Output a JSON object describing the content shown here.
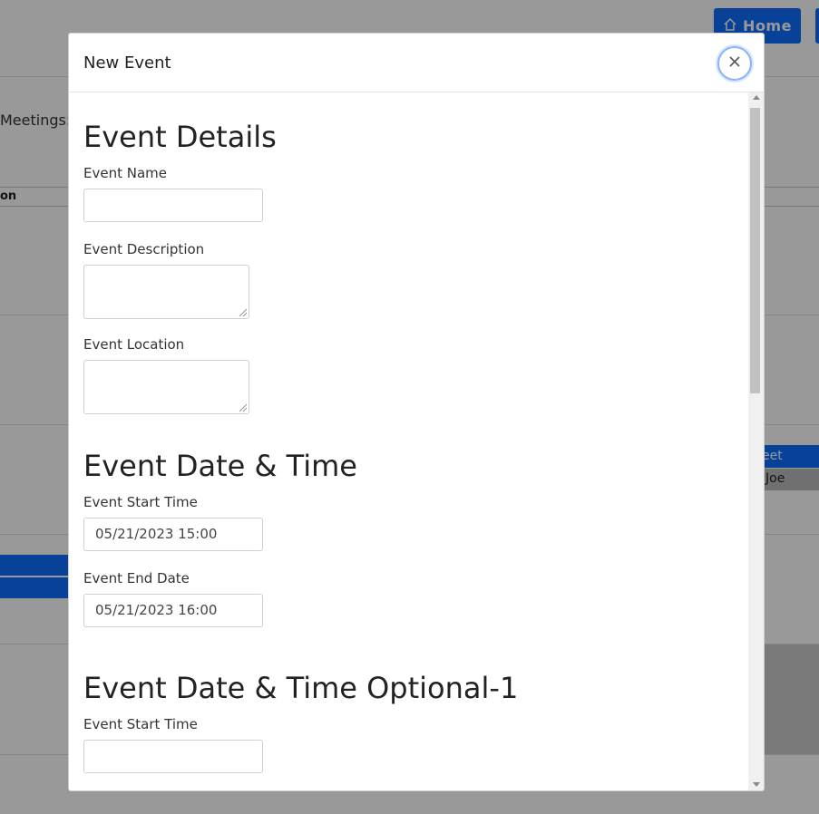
{
  "background": {
    "home_button_label": "Home",
    "meetings_label": "Meetings:",
    "column_header_fragment": "on",
    "right_chip_1": "eet",
    "right_chip_2": "Joe"
  },
  "modal": {
    "title": "New Event",
    "close_icon": "close-icon",
    "sections": {
      "details": {
        "title": "Event Details",
        "event_name_label": "Event Name",
        "event_name_value": "",
        "event_description_label": "Event Description",
        "event_location_label": "Event Location"
      },
      "date_time": {
        "title": "Event Date & Time",
        "start_label": "Event Start Time",
        "start_value": "05/21/2023 15:00",
        "end_label": "Event End Date",
        "end_value": "05/21/2023 16:00"
      },
      "date_time_optional_1": {
        "title": "Event Date & Time Optional-1",
        "start_label": "Event Start Time",
        "start_value": ""
      }
    }
  },
  "colors": {
    "primary": "#0d6efd",
    "overlay": "rgba(0,0,0,0.4)"
  }
}
